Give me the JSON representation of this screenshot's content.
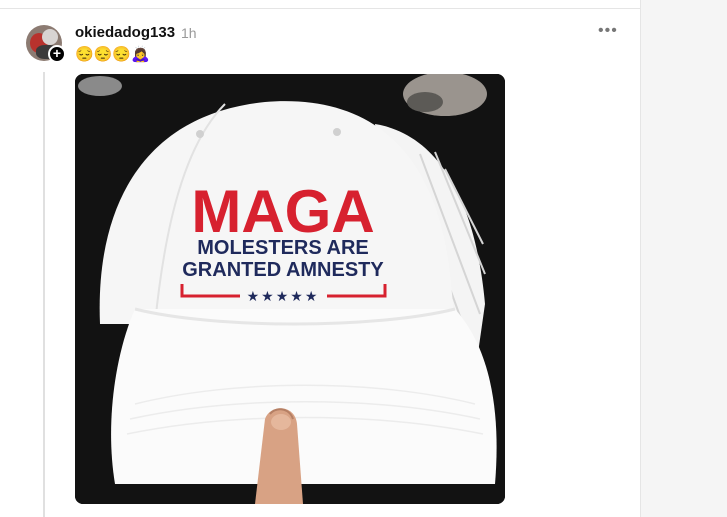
{
  "post": {
    "username": "okiedadog133",
    "time": "1h",
    "text": "😔😔😔🙇‍♀️",
    "more_icon": "•••",
    "follow_icon": "+"
  },
  "image": {
    "hat_line1": "MAGA",
    "hat_line2": "MOLESTERS ARE",
    "hat_line3": "GRANTED AMNESTY",
    "stars": "★★★★★"
  },
  "colors": {
    "brand_red": "#d7212f",
    "navy": "#1f2a5c"
  }
}
